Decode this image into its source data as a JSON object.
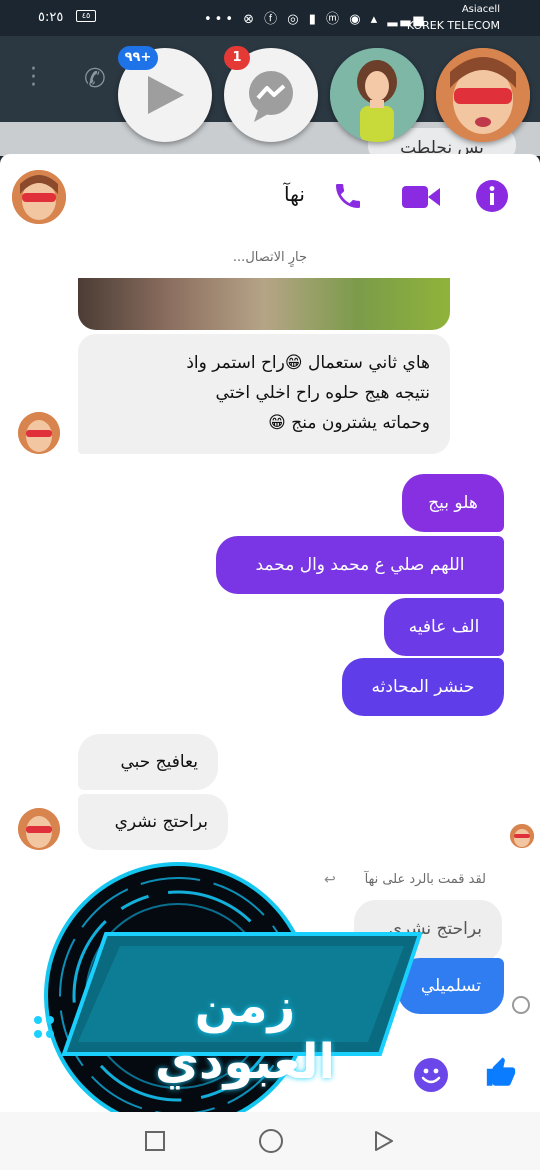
{
  "status_bar": {
    "time": "٥:٢٥",
    "battery": "٤٥",
    "icons": "••• ⊗ ⓕ ◎ ▮ ⓜ ◉ ▴ ▂▃▅",
    "carrier_top": "Asiacell",
    "carrier_bottom": "KOREK TELECOM"
  },
  "background": {
    "bubble_text": "بس نحلطت"
  },
  "chat_heads": {
    "play_badge": "٩٩+",
    "messenger_badge": "1"
  },
  "conversation": {
    "contact_name": "نهآ",
    "status": "جارٍ الاتصال...",
    "messages_in_1": [
      "هاي ثاني ستعمال 😁راح استمر واذ",
      "نتيجه هيج حلوه راح اخلي اختي",
      "وحماته يشترون منج 😁"
    ],
    "messages_out": [
      "هلو بيج",
      "اللهم صلي ع محمد وال محمد",
      "الف عافيه",
      "حنشر المحادثه"
    ],
    "messages_in_2": [
      "يعافيج حبي",
      "براحتج نشري"
    ],
    "reply_note": "لقد قمت بالرد على نهآ",
    "quoted": "براحتج نشري",
    "reply_message": "تسلميلي"
  },
  "watermark": {
    "text": "زمن العبودي"
  },
  "colors": {
    "messenger_purple": "#8a2be2",
    "bubble_out_blue": "#5f3de8",
    "bubble_in": "#f0f0f0",
    "like_blue": "#0a7cff"
  }
}
